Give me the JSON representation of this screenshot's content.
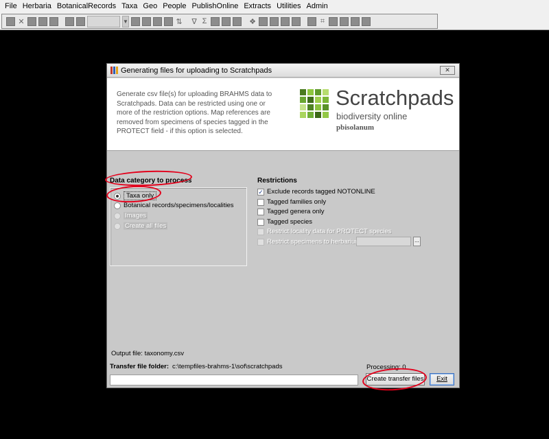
{
  "menu": [
    "File",
    "Herbaria",
    "BotanicalRecords",
    "Taxa",
    "Geo",
    "People",
    "PublishOnline",
    "Extracts",
    "Utilities",
    "Admin"
  ],
  "toolbar": {
    "icons": [
      "toolbar-button",
      "delete-icon",
      "toolbar-button",
      "toolbar-button",
      "toolbar-button",
      "toolbar-button",
      "toolbar-button",
      "combo",
      "toolbar-button",
      "toolbar-button",
      "toolbar-button",
      "toolbar-button",
      "sort-az-icon",
      "filter-icon",
      "sum-icon",
      "toolbar-button",
      "toolbar-button",
      "map-icon",
      "toolbar-button",
      "toolbar-button",
      "toolbar-button",
      "tag-icon",
      "toolbar-button",
      "toolbar-button",
      "toolbar-button"
    ]
  },
  "dialog": {
    "title": "Generating files for uploading to Scratchpads",
    "close_glyph": "✕",
    "description": "Generate csv file(s) for uploading BRAHMS data to Scratchpads. Data can be restricted using one or more of the restriction options. Map references are removed  from specimens of species tagged in the PROTECT field - if this option is selected.",
    "logo": {
      "name": "Scratchpads",
      "tagline": "biodiversity online",
      "user": "pbisolanum",
      "colors": [
        "#4a7a1e",
        "#8ec63f",
        "#5e9a2a",
        "#b7dc6f",
        "#6aa631",
        "#3f6d18",
        "#9fce4d",
        "#7cb637",
        "#c5e389",
        "#4e8322",
        "#8bc23e",
        "#5a9228",
        "#a9d55e",
        "#6fae35",
        "#3c6816",
        "#93c846"
      ]
    },
    "data_category": {
      "label": "Data category to process",
      "options": [
        {
          "label": "Taxa only",
          "selected": true,
          "enabled": true
        },
        {
          "label": "Botanical records/specimens/localities",
          "selected": false,
          "enabled": true
        },
        {
          "label": "Images",
          "selected": false,
          "enabled": false
        },
        {
          "label": "Create all files",
          "selected": false,
          "enabled": false
        }
      ]
    },
    "restrictions": {
      "label": "Restrictions",
      "options": [
        {
          "label": "Exclude records tagged NOTONLINE",
          "checked": true,
          "enabled": true
        },
        {
          "label": "Tagged families only",
          "checked": false,
          "enabled": true
        },
        {
          "label": "Tagged genera only",
          "checked": false,
          "enabled": true
        },
        {
          "label": "Tagged species",
          "checked": false,
          "enabled": true
        },
        {
          "label": "Restrict locality data for PROTECT species",
          "checked": false,
          "enabled": false
        },
        {
          "label": "Restrict specimens to herbarium",
          "checked": false,
          "enabled": false
        }
      ],
      "herbarium_value": "",
      "browse_label": "..."
    },
    "output_file": "Output file: taxonomy.csv",
    "transfer_folder_label": "Transfer file folder:",
    "transfer_folder_value": "c:\\tempfiles-brahms-1\\sof\\scratchpads",
    "processing": "Processing:  0",
    "path_value": "",
    "create_button": "Create transfer files",
    "exit_button": "Exit"
  }
}
